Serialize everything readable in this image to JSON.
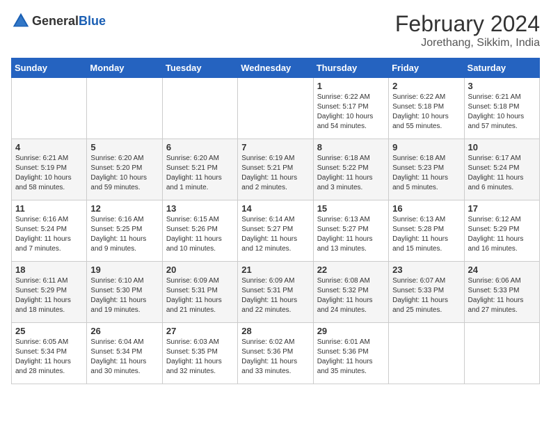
{
  "header": {
    "logo_general": "General",
    "logo_blue": "Blue",
    "month": "February 2024",
    "location": "Jorethang, Sikkim, India"
  },
  "weekdays": [
    "Sunday",
    "Monday",
    "Tuesday",
    "Wednesday",
    "Thursday",
    "Friday",
    "Saturday"
  ],
  "weeks": [
    [
      {
        "day": "",
        "info": ""
      },
      {
        "day": "",
        "info": ""
      },
      {
        "day": "",
        "info": ""
      },
      {
        "day": "",
        "info": ""
      },
      {
        "day": "1",
        "info": "Sunrise: 6:22 AM\nSunset: 5:17 PM\nDaylight: 10 hours\nand 54 minutes."
      },
      {
        "day": "2",
        "info": "Sunrise: 6:22 AM\nSunset: 5:18 PM\nDaylight: 10 hours\nand 55 minutes."
      },
      {
        "day": "3",
        "info": "Sunrise: 6:21 AM\nSunset: 5:18 PM\nDaylight: 10 hours\nand 57 minutes."
      }
    ],
    [
      {
        "day": "4",
        "info": "Sunrise: 6:21 AM\nSunset: 5:19 PM\nDaylight: 10 hours\nand 58 minutes."
      },
      {
        "day": "5",
        "info": "Sunrise: 6:20 AM\nSunset: 5:20 PM\nDaylight: 10 hours\nand 59 minutes."
      },
      {
        "day": "6",
        "info": "Sunrise: 6:20 AM\nSunset: 5:21 PM\nDaylight: 11 hours\nand 1 minute."
      },
      {
        "day": "7",
        "info": "Sunrise: 6:19 AM\nSunset: 5:21 PM\nDaylight: 11 hours\nand 2 minutes."
      },
      {
        "day": "8",
        "info": "Sunrise: 6:18 AM\nSunset: 5:22 PM\nDaylight: 11 hours\nand 3 minutes."
      },
      {
        "day": "9",
        "info": "Sunrise: 6:18 AM\nSunset: 5:23 PM\nDaylight: 11 hours\nand 5 minutes."
      },
      {
        "day": "10",
        "info": "Sunrise: 6:17 AM\nSunset: 5:24 PM\nDaylight: 11 hours\nand 6 minutes."
      }
    ],
    [
      {
        "day": "11",
        "info": "Sunrise: 6:16 AM\nSunset: 5:24 PM\nDaylight: 11 hours\nand 7 minutes."
      },
      {
        "day": "12",
        "info": "Sunrise: 6:16 AM\nSunset: 5:25 PM\nDaylight: 11 hours\nand 9 minutes."
      },
      {
        "day": "13",
        "info": "Sunrise: 6:15 AM\nSunset: 5:26 PM\nDaylight: 11 hours\nand 10 minutes."
      },
      {
        "day": "14",
        "info": "Sunrise: 6:14 AM\nSunset: 5:27 PM\nDaylight: 11 hours\nand 12 minutes."
      },
      {
        "day": "15",
        "info": "Sunrise: 6:13 AM\nSunset: 5:27 PM\nDaylight: 11 hours\nand 13 minutes."
      },
      {
        "day": "16",
        "info": "Sunrise: 6:13 AM\nSunset: 5:28 PM\nDaylight: 11 hours\nand 15 minutes."
      },
      {
        "day": "17",
        "info": "Sunrise: 6:12 AM\nSunset: 5:29 PM\nDaylight: 11 hours\nand 16 minutes."
      }
    ],
    [
      {
        "day": "18",
        "info": "Sunrise: 6:11 AM\nSunset: 5:29 PM\nDaylight: 11 hours\nand 18 minutes."
      },
      {
        "day": "19",
        "info": "Sunrise: 6:10 AM\nSunset: 5:30 PM\nDaylight: 11 hours\nand 19 minutes."
      },
      {
        "day": "20",
        "info": "Sunrise: 6:09 AM\nSunset: 5:31 PM\nDaylight: 11 hours\nand 21 minutes."
      },
      {
        "day": "21",
        "info": "Sunrise: 6:09 AM\nSunset: 5:31 PM\nDaylight: 11 hours\nand 22 minutes."
      },
      {
        "day": "22",
        "info": "Sunrise: 6:08 AM\nSunset: 5:32 PM\nDaylight: 11 hours\nand 24 minutes."
      },
      {
        "day": "23",
        "info": "Sunrise: 6:07 AM\nSunset: 5:33 PM\nDaylight: 11 hours\nand 25 minutes."
      },
      {
        "day": "24",
        "info": "Sunrise: 6:06 AM\nSunset: 5:33 PM\nDaylight: 11 hours\nand 27 minutes."
      }
    ],
    [
      {
        "day": "25",
        "info": "Sunrise: 6:05 AM\nSunset: 5:34 PM\nDaylight: 11 hours\nand 28 minutes."
      },
      {
        "day": "26",
        "info": "Sunrise: 6:04 AM\nSunset: 5:34 PM\nDaylight: 11 hours\nand 30 minutes."
      },
      {
        "day": "27",
        "info": "Sunrise: 6:03 AM\nSunset: 5:35 PM\nDaylight: 11 hours\nand 32 minutes."
      },
      {
        "day": "28",
        "info": "Sunrise: 6:02 AM\nSunset: 5:36 PM\nDaylight: 11 hours\nand 33 minutes."
      },
      {
        "day": "29",
        "info": "Sunrise: 6:01 AM\nSunset: 5:36 PM\nDaylight: 11 hours\nand 35 minutes."
      },
      {
        "day": "",
        "info": ""
      },
      {
        "day": "",
        "info": ""
      }
    ]
  ]
}
